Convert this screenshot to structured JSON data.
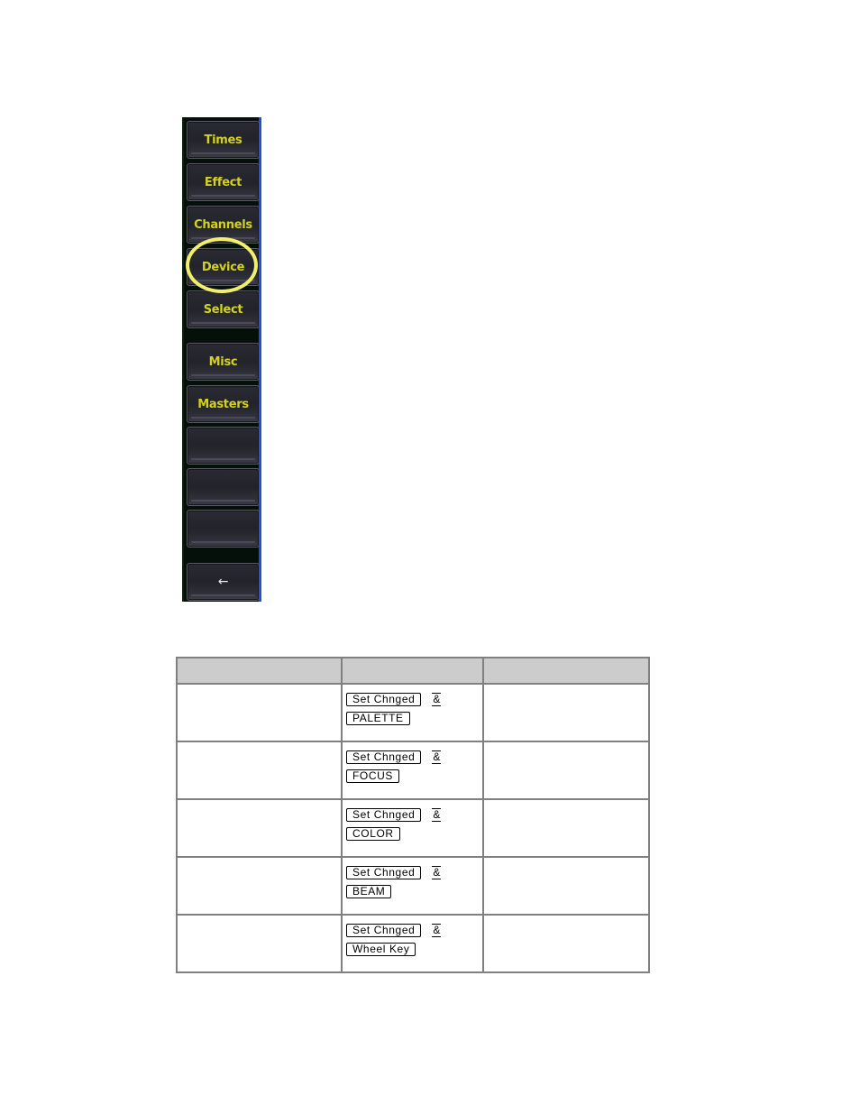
{
  "console_panel": {
    "buttons": [
      {
        "label": "Times"
      },
      {
        "label": "Effect"
      },
      {
        "label": "Channels"
      },
      {
        "label": "Device",
        "highlighted": true
      },
      {
        "label": "Select"
      },
      {
        "label": "Misc"
      },
      {
        "label": "Masters"
      },
      {
        "label": ""
      },
      {
        "label": ""
      },
      {
        "label": ""
      },
      {
        "label": "←",
        "icon": "back-arrow-icon"
      }
    ],
    "colors": {
      "label": "#d4d21a",
      "highlight_ring": "#f2ef6a",
      "edge_accent": "#1f4fe0"
    }
  },
  "table": {
    "headers": [
      "",
      "",
      ""
    ],
    "rows": [
      {
        "col1": "",
        "keys": [
          "Set Chnged",
          "PALETTE"
        ],
        "connector": "&",
        "col3": ""
      },
      {
        "col1": "",
        "keys": [
          "Set Chnged",
          "FOCUS"
        ],
        "connector": "&",
        "col3": ""
      },
      {
        "col1": "",
        "keys": [
          "Set Chnged",
          "COLOR"
        ],
        "connector": "&",
        "col3": ""
      },
      {
        "col1": "",
        "keys": [
          "Set Chnged",
          "BEAM"
        ],
        "connector": "&",
        "col3": ""
      },
      {
        "col1": "",
        "keys": [
          "Set Chnged",
          "Wheel Key"
        ],
        "connector": "&",
        "col3": ""
      }
    ]
  }
}
